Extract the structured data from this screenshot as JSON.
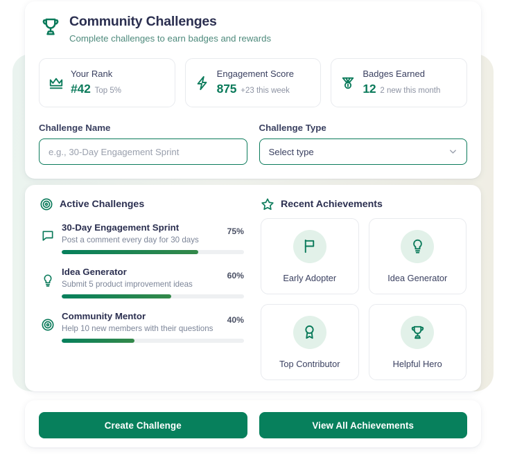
{
  "header": {
    "icon": "trophy-icon",
    "title": "Community Challenges",
    "subtitle": "Complete challenges to earn badges and rewards"
  },
  "stats": [
    {
      "icon": "crown-icon",
      "label": "Your Rank",
      "value": "#42",
      "note": "Top 5%"
    },
    {
      "icon": "lightning-icon",
      "label": "Engagement Score",
      "value": "875",
      "note": "+23 this week"
    },
    {
      "icon": "medal-icon",
      "label": "Badges Earned",
      "value": "12",
      "note": "2 new this month"
    }
  ],
  "form": {
    "name_label": "Challenge Name",
    "name_value": "",
    "name_placeholder": "e.g., 30-Day Engagement Sprint",
    "type_label": "Challenge Type",
    "type_selected": "Select type"
  },
  "active_challenges": {
    "icon": "target-icon",
    "title": "Active Challenges",
    "items": [
      {
        "icon": "comment-icon",
        "name": "30-Day Engagement Sprint",
        "desc": "Post a comment every day for 30 days",
        "percent_label": "75%",
        "percent": 75
      },
      {
        "icon": "lightbulb-icon",
        "name": "Idea Generator",
        "desc": "Submit 5 product improvement ideas",
        "percent_label": "60%",
        "percent": 60
      },
      {
        "icon": "target-icon",
        "name": "Community Mentor",
        "desc": "Help 10 new members with their questions",
        "percent_label": "40%",
        "percent": 40
      }
    ]
  },
  "recent_achievements": {
    "icon": "star-icon",
    "title": "Recent Achievements",
    "items": [
      {
        "icon": "flag-icon",
        "label": "Early Adopter"
      },
      {
        "icon": "lightbulb-icon",
        "label": "Idea Generator"
      },
      {
        "icon": "award-icon",
        "label": "Top Contributor"
      },
      {
        "icon": "trophy-icon",
        "label": "Helpful Hero"
      }
    ]
  },
  "actions": {
    "primary_label": "Create Challenge",
    "secondary_label": "View All Achievements"
  },
  "colors": {
    "brand_green": "#07805c",
    "title_navy": "#2b2f50",
    "subtitle_teal": "#4e8a7c",
    "muted_gray": "#8d93a3",
    "progress_start": "#07805c",
    "progress_end": "#f59e0b",
    "badge_circle": "#e2f1e9"
  }
}
